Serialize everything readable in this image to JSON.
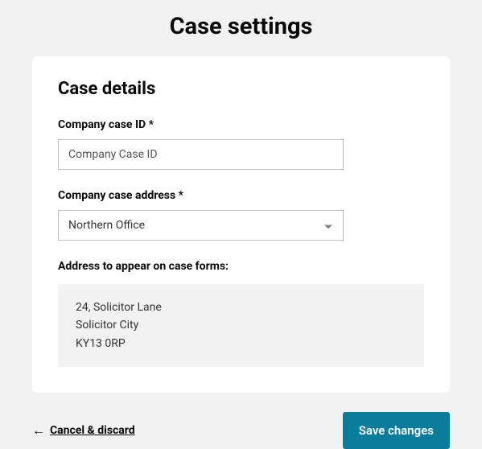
{
  "page": {
    "title": "Case settings"
  },
  "card": {
    "title": "Case details",
    "fields": {
      "case_id": {
        "label": "Company case ID *",
        "placeholder": "Company Case ID",
        "value": ""
      },
      "case_address": {
        "label": "Company case address *",
        "selected": "Northern Office"
      }
    },
    "address_preview": {
      "label": "Address to appear on case forms:",
      "line1": "24, Solicitor Lane",
      "line2": "Solicitor City",
      "line3": "KY13 0RP"
    }
  },
  "footer": {
    "cancel_label": "Cancel & discard",
    "save_label": "Save changes"
  }
}
